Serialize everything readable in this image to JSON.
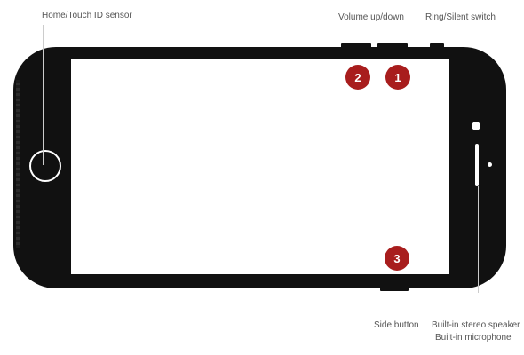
{
  "labels": {
    "home": "Home/Touch ID sensor",
    "volume": "Volume up/down",
    "ring": "Ring/Silent switch",
    "side": "Side button",
    "speaker": "Built-in stereo speaker",
    "microphone": "Built-in microphone"
  },
  "badges": [
    "2",
    "1",
    "3"
  ],
  "colors": {
    "device": "#111111",
    "badge": "#a81d1d",
    "label": "#555555"
  }
}
